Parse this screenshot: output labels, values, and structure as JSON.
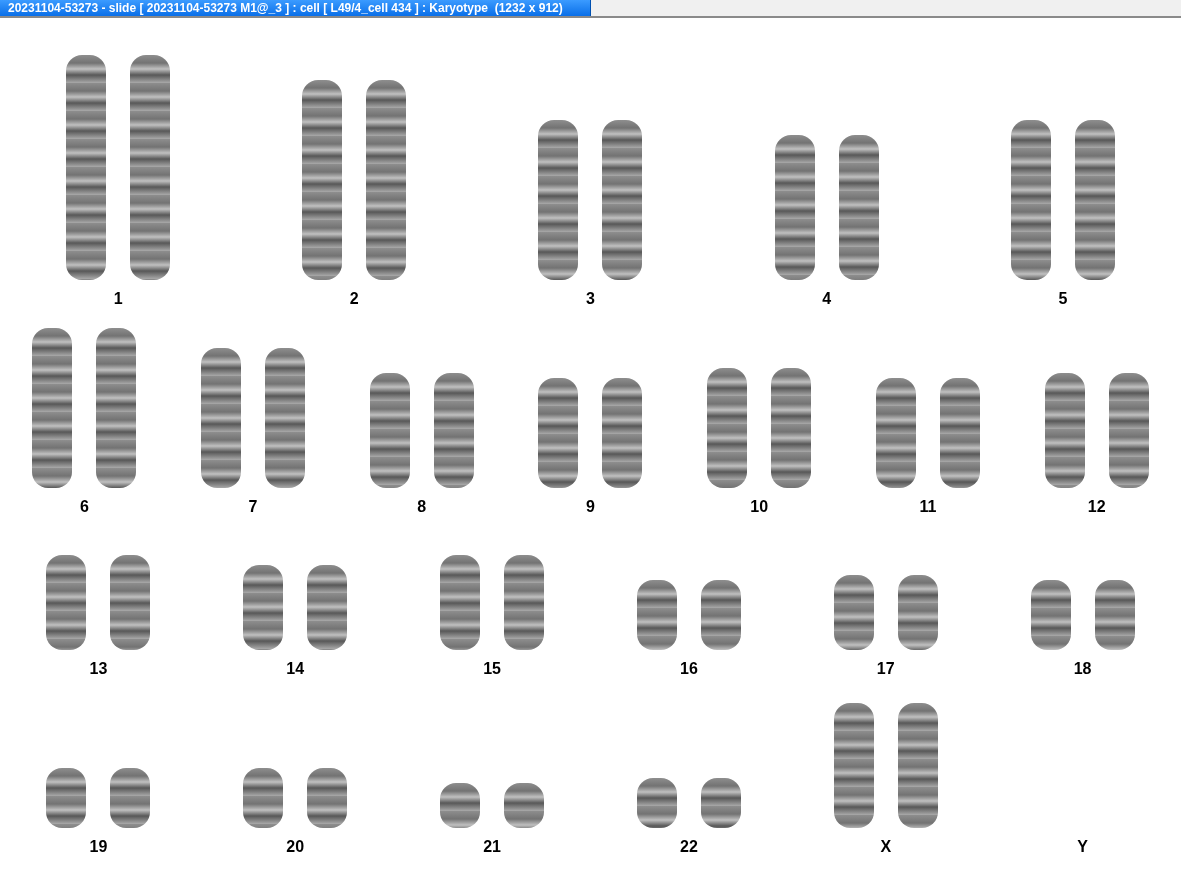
{
  "window": {
    "title": "20231104-53273 - slide [ 20231104-53273 M1@_3 ] : cell [ L49/4_cell 434 ] : Karyotype  (1232 x 912)"
  },
  "karyotype": {
    "rows": [
      [
        {
          "label": "1",
          "kind": "pair"
        },
        {
          "label": "2",
          "kind": "pair"
        },
        {
          "label": "3",
          "kind": "pair"
        },
        {
          "label": "4",
          "kind": "pair"
        },
        {
          "label": "5",
          "kind": "pair"
        }
      ],
      [
        {
          "label": "6",
          "kind": "pair"
        },
        {
          "label": "7",
          "kind": "pair"
        },
        {
          "label": "8",
          "kind": "pair"
        },
        {
          "label": "9",
          "kind": "pair"
        },
        {
          "label": "10",
          "kind": "pair"
        },
        {
          "label": "11",
          "kind": "pair"
        },
        {
          "label": "12",
          "kind": "pair"
        }
      ],
      [
        {
          "label": "13",
          "kind": "pair"
        },
        {
          "label": "14",
          "kind": "pair"
        },
        {
          "label": "15",
          "kind": "pair"
        },
        {
          "label": "16",
          "kind": "pair"
        },
        {
          "label": "17",
          "kind": "pair"
        },
        {
          "label": "18",
          "kind": "pair"
        }
      ],
      [
        {
          "label": "19",
          "kind": "pair"
        },
        {
          "label": "20",
          "kind": "pair"
        },
        {
          "label": "21",
          "kind": "pair"
        },
        {
          "label": "22",
          "kind": "pair"
        },
        {
          "label": "X",
          "kind": "pair"
        },
        {
          "label": "Y",
          "kind": "empty"
        }
      ]
    ]
  }
}
